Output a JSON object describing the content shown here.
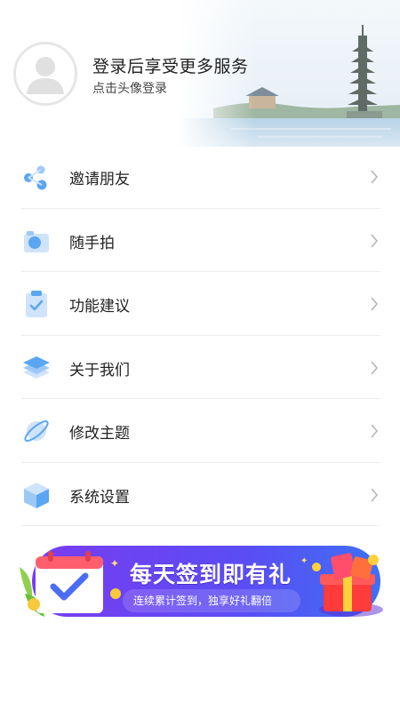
{
  "header": {
    "login_title": "登录后享受更多服务",
    "login_subtitle": "点击头像登录"
  },
  "menu": {
    "items": [
      {
        "label": "邀请朋友",
        "icon": "share-icon"
      },
      {
        "label": "随手拍",
        "icon": "camera-icon"
      },
      {
        "label": "功能建议",
        "icon": "clipboard-check-icon"
      },
      {
        "label": "关于我们",
        "icon": "layers-icon"
      },
      {
        "label": "修改主题",
        "icon": "planet-icon"
      },
      {
        "label": "系统设置",
        "icon": "cube-icon"
      }
    ]
  },
  "banner": {
    "title": "每天签到即有礼",
    "subtitle": "连续累计签到，独享好礼翻倍"
  },
  "colors": {
    "icon_blue": "#5aa6f2",
    "icon_light": "#cfe3fb",
    "banner_purple": "#6a3cf0",
    "banner_blue": "#3b6cf5"
  }
}
